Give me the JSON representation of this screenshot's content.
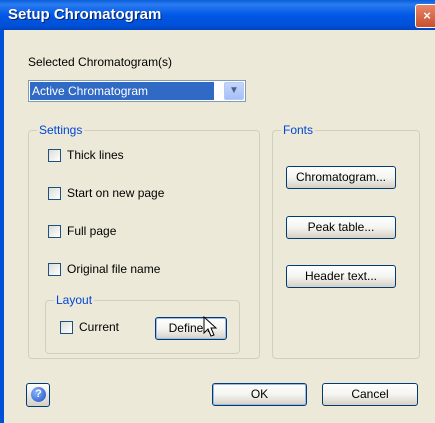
{
  "window": {
    "title": "Setup Chromatogram",
    "close_glyph": "×"
  },
  "selected": {
    "label": "Selected Chromatogram(s)",
    "value": "Active Chromatogram",
    "arrow_glyph": "▼"
  },
  "settings": {
    "title": "Settings",
    "checkboxes": [
      {
        "label": "Thick lines",
        "checked": false
      },
      {
        "label": "Start on new page",
        "checked": false
      },
      {
        "label": "Full page",
        "checked": false
      },
      {
        "label": "Original file name",
        "checked": false
      }
    ],
    "layout": {
      "title": "Layout",
      "current_label": "Current",
      "current_checked": false,
      "define_label": "Define..."
    }
  },
  "fonts": {
    "title": "Fonts",
    "buttons": [
      "Chromatogram...",
      "Peak table...",
      "Header text..."
    ]
  },
  "footer": {
    "ok_label": "OK",
    "cancel_label": "Cancel",
    "help_glyph": "?"
  }
}
